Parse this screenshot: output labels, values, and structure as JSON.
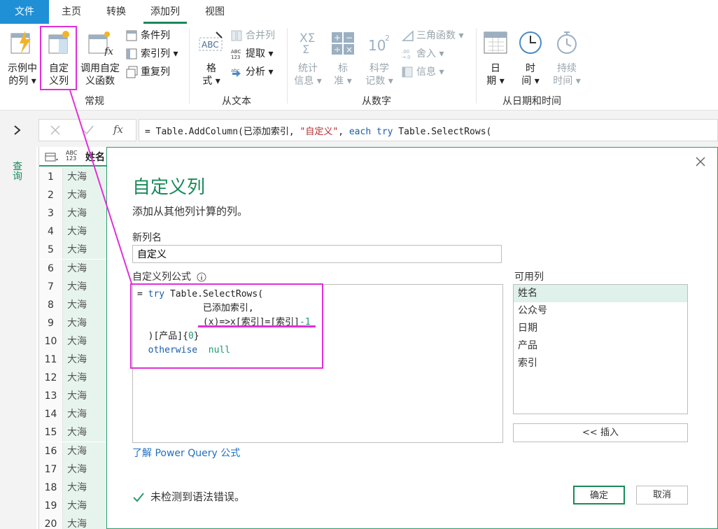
{
  "ribbon": {
    "tabs": [
      "文件",
      "主页",
      "转换",
      "添加列",
      "视图"
    ],
    "buttons": {
      "col_from_examples": [
        "示例中",
        "的列"
      ],
      "custom_column": [
        "自定",
        "义列"
      ],
      "invoke_custom_fn": [
        "调用自定",
        "义函数"
      ],
      "conditional_column": "条件列",
      "index_column": "索引列",
      "duplicate_column": "重复列",
      "format": [
        "格",
        "式"
      ],
      "merge_columns": "合并列",
      "extract": "提取",
      "parse": "分析",
      "statistics": [
        "统计",
        "信息"
      ],
      "standard": [
        "标",
        "准"
      ],
      "scientific": [
        "科学",
        "记数"
      ],
      "trigonometry": "三角函数",
      "rounding": "舍入",
      "information": "信息",
      "date": [
        "日",
        "期"
      ],
      "time": [
        "时",
        "间"
      ],
      "duration": [
        "持续",
        "时间"
      ]
    },
    "groups": [
      "常规",
      "从文本",
      "从数字",
      "从日期和时间"
    ]
  },
  "formula_bar": {
    "prefix": "= ",
    "parts": [
      {
        "t": "Table.AddColumn(",
        "c": ""
      },
      {
        "t": "已添加索引, ",
        "c": ""
      },
      {
        "t": "\"自定义\"",
        "c": "str"
      },
      {
        "t": ", ",
        "c": ""
      },
      {
        "t": "each try",
        "c": "kw"
      },
      {
        "t": " Table.SelectRows(",
        "c": ""
      }
    ]
  },
  "query_pane": {
    "label": "查询"
  },
  "grid": {
    "header_type": "ABC 123",
    "header_name": "姓名",
    "rows": [
      {
        "n": "1",
        "v": "大海"
      },
      {
        "n": "2",
        "v": "大海"
      },
      {
        "n": "3",
        "v": "大海"
      },
      {
        "n": "4",
        "v": "大海"
      },
      {
        "n": "5",
        "v": "大海"
      },
      {
        "n": "6",
        "v": "大海"
      },
      {
        "n": "7",
        "v": "大海"
      },
      {
        "n": "8",
        "v": "大海"
      },
      {
        "n": "9",
        "v": "大海"
      },
      {
        "n": "10",
        "v": "大海"
      },
      {
        "n": "11",
        "v": "大海"
      },
      {
        "n": "12",
        "v": "大海"
      },
      {
        "n": "13",
        "v": "大海"
      },
      {
        "n": "14",
        "v": "大海"
      },
      {
        "n": "15",
        "v": "大海"
      },
      {
        "n": "16",
        "v": "大海"
      },
      {
        "n": "17",
        "v": "大海"
      },
      {
        "n": "18",
        "v": "大海"
      },
      {
        "n": "19",
        "v": "大海"
      },
      {
        "n": "20",
        "v": "大海"
      }
    ]
  },
  "dialog": {
    "title": "自定义列",
    "subtitle": "添加从其他列计算的列。",
    "new_col_label": "新列名",
    "new_col_value": "自定义",
    "formula_label": "自定义列公式",
    "formula_lines": [
      [
        {
          "t": "= ",
          "c": ""
        },
        {
          "t": "try",
          "c": "kw"
        },
        {
          "t": " Table.SelectRows(",
          "c": ""
        }
      ],
      [
        {
          "t": "            已添加索引,",
          "c": ""
        }
      ],
      [
        {
          "t": "            (x)=>x[索引]=[索引]",
          "c": ""
        },
        {
          "t": "-1",
          "c": "num"
        }
      ],
      [
        {
          "t": "  )[产品]{",
          "c": ""
        },
        {
          "t": "0",
          "c": "num"
        },
        {
          "t": "}",
          "c": ""
        }
      ],
      [
        {
          "t": "  ",
          "c": ""
        },
        {
          "t": "otherwise",
          "c": "kw"
        },
        {
          "t": "  ",
          "c": ""
        },
        {
          "t": "null",
          "c": "num"
        }
      ]
    ],
    "available_label": "可用列",
    "available_columns": [
      "姓名",
      "公众号",
      "日期",
      "产品",
      "索引"
    ],
    "insert_button": "<< 插入",
    "learn_link": "了解 Power Query 公式",
    "status": "未检测到语法错误。",
    "ok_button": "确定",
    "cancel_button": "取消"
  },
  "colors": {
    "accent": "#1a8a5a",
    "annotation": "#e030d8",
    "file_tab": "#1f8fd6"
  }
}
